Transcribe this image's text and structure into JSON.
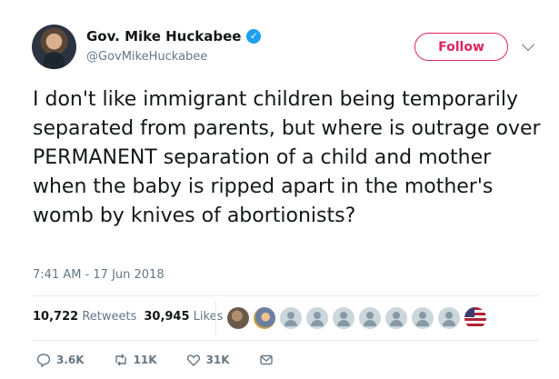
{
  "author": {
    "display_name": "Gov. Mike Huckabee",
    "handle": "@GovMikeHuckabee",
    "verified_icon": "verified-badge-icon"
  },
  "follow_button": {
    "label": "Follow",
    "color": "#e0245e"
  },
  "tweet": {
    "text": "I don't like immigrant children being temporarily separated from parents, but where is outrage over PERMANENT separation of a child and mother when the baby is ripped apart in the mother's womb by knives of abortionists?",
    "timestamp": "7:41 AM - 17 Jun 2018"
  },
  "stats": {
    "retweets_count": "10,722",
    "retweets_label": "Retweets",
    "likes_count": "30,945",
    "likes_label": "Likes"
  },
  "likers": [
    "photo1",
    "photo2",
    "default",
    "default",
    "default",
    "default",
    "default",
    "default",
    "default",
    "flag"
  ],
  "actions": {
    "reply_count": "3.6K",
    "retweet_count": "11K",
    "like_count": "31K"
  },
  "colors": {
    "text": "#14171a",
    "secondary": "#657786",
    "verified": "#1da1f2",
    "divider": "#e6ecf0"
  }
}
